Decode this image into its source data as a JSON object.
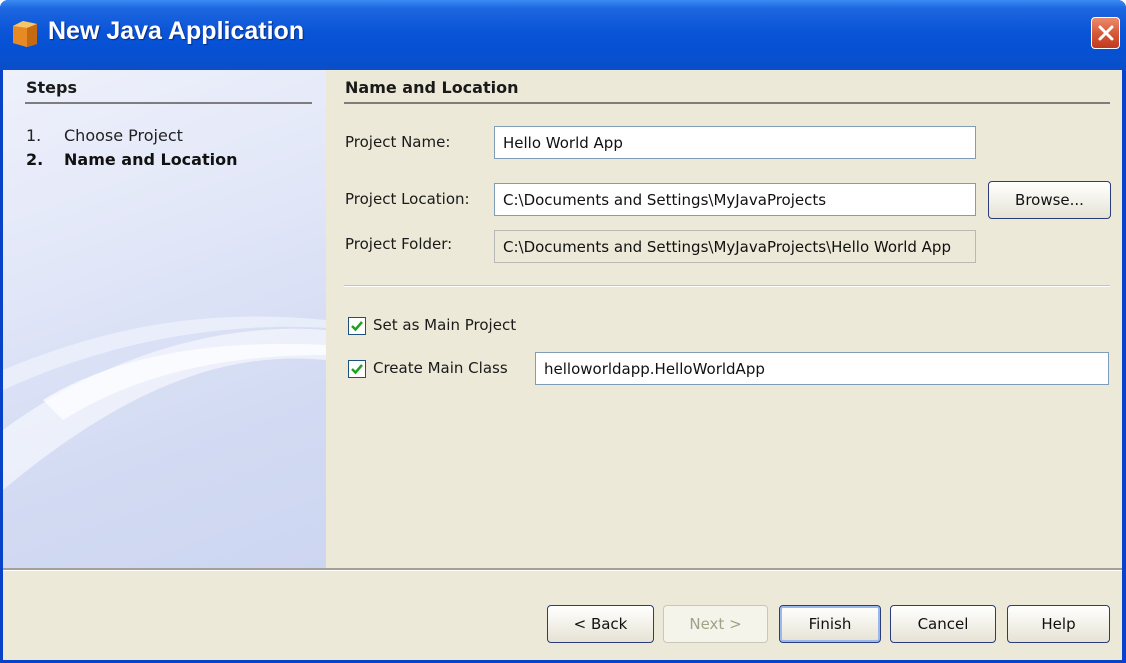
{
  "window": {
    "title": "New Java Application",
    "app_icon": "java-cup-icon",
    "close_icon": "close-icon",
    "colors": {
      "title_bar": "#0a54d8",
      "close_button": "#d65a38",
      "client_bg": "#ece9d8"
    }
  },
  "steps": {
    "title": "Steps",
    "items": [
      {
        "number": "1.",
        "label": "Choose Project",
        "current": false
      },
      {
        "number": "2.",
        "label": "Name and Location",
        "current": true
      }
    ]
  },
  "form": {
    "section_title": "Name and Location",
    "project_name": {
      "label": "Project Name:",
      "value": "Hello World App"
    },
    "project_location": {
      "label": "Project Location:",
      "value": "C:\\Documents and Settings\\MyJavaProjects",
      "browse_label": "Browse..."
    },
    "project_folder": {
      "label": "Project Folder:",
      "value": "C:\\Documents and Settings\\MyJavaProjects\\Hello World App"
    },
    "set_main_project": {
      "label": "Set as Main Project",
      "checked": true
    },
    "create_main_class": {
      "label": "Create Main Class",
      "checked": true,
      "value": "helloworldapp.HelloWorldApp"
    }
  },
  "buttons": {
    "back": "< Back",
    "next": "Next >",
    "finish": "Finish",
    "cancel": "Cancel",
    "help": "Help"
  }
}
